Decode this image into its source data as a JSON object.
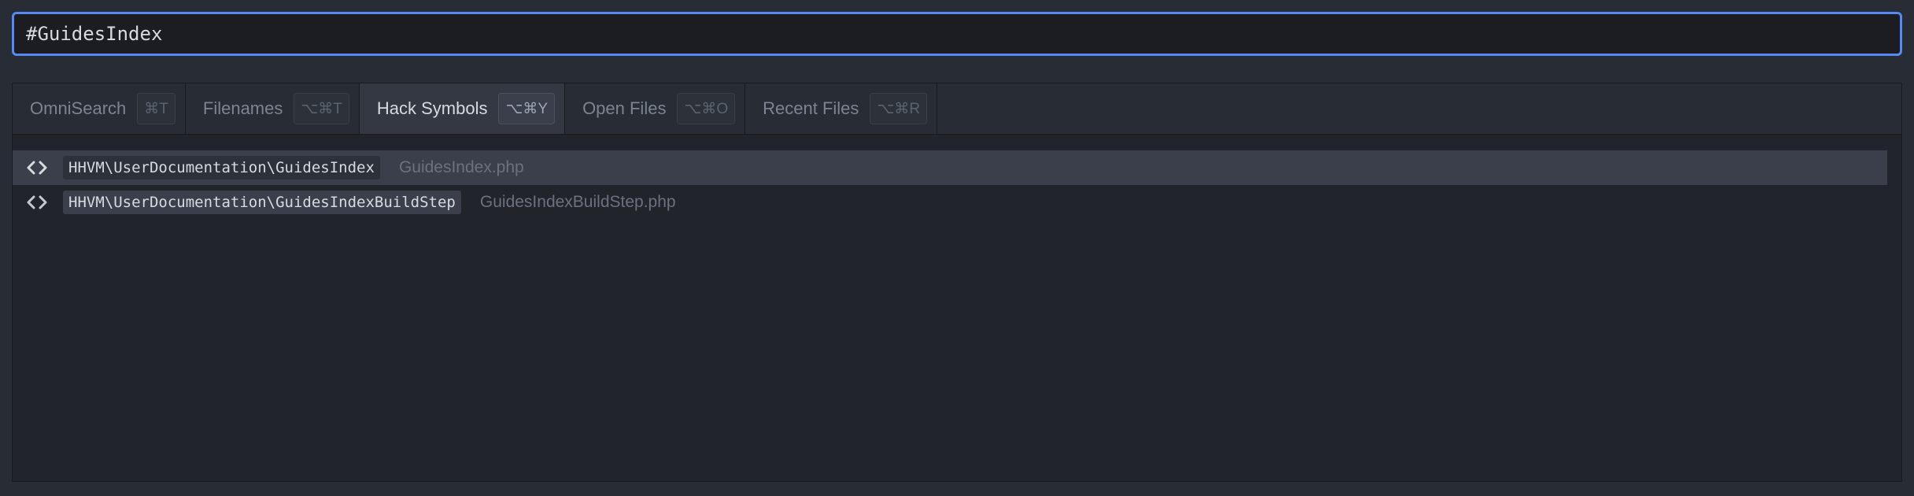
{
  "search": {
    "value": "#GuidesIndex"
  },
  "tabs": [
    {
      "label": "OmniSearch",
      "shortcut": "⌘T",
      "active": false
    },
    {
      "label": "Filenames",
      "shortcut": "⌥⌘T",
      "active": false
    },
    {
      "label": "Hack Symbols",
      "shortcut": "⌥⌘Y",
      "active": true
    },
    {
      "label": "Open Files",
      "shortcut": "⌥⌘O",
      "active": false
    },
    {
      "label": "Recent Files",
      "shortcut": "⌥⌘R",
      "active": false
    }
  ],
  "results": [
    {
      "icon": "code-icon",
      "symbol": "HHVM\\UserDocumentation\\GuidesIndex",
      "file": "GuidesIndex.php",
      "selected": true
    },
    {
      "icon": "code-icon",
      "symbol": "HHVM\\UserDocumentation\\GuidesIndexBuildStep",
      "file": "GuidesIndexBuildStep.php",
      "selected": false
    }
  ],
  "colors": {
    "accent": "#568af2",
    "background": "#282c34",
    "panel": "#21252b"
  }
}
